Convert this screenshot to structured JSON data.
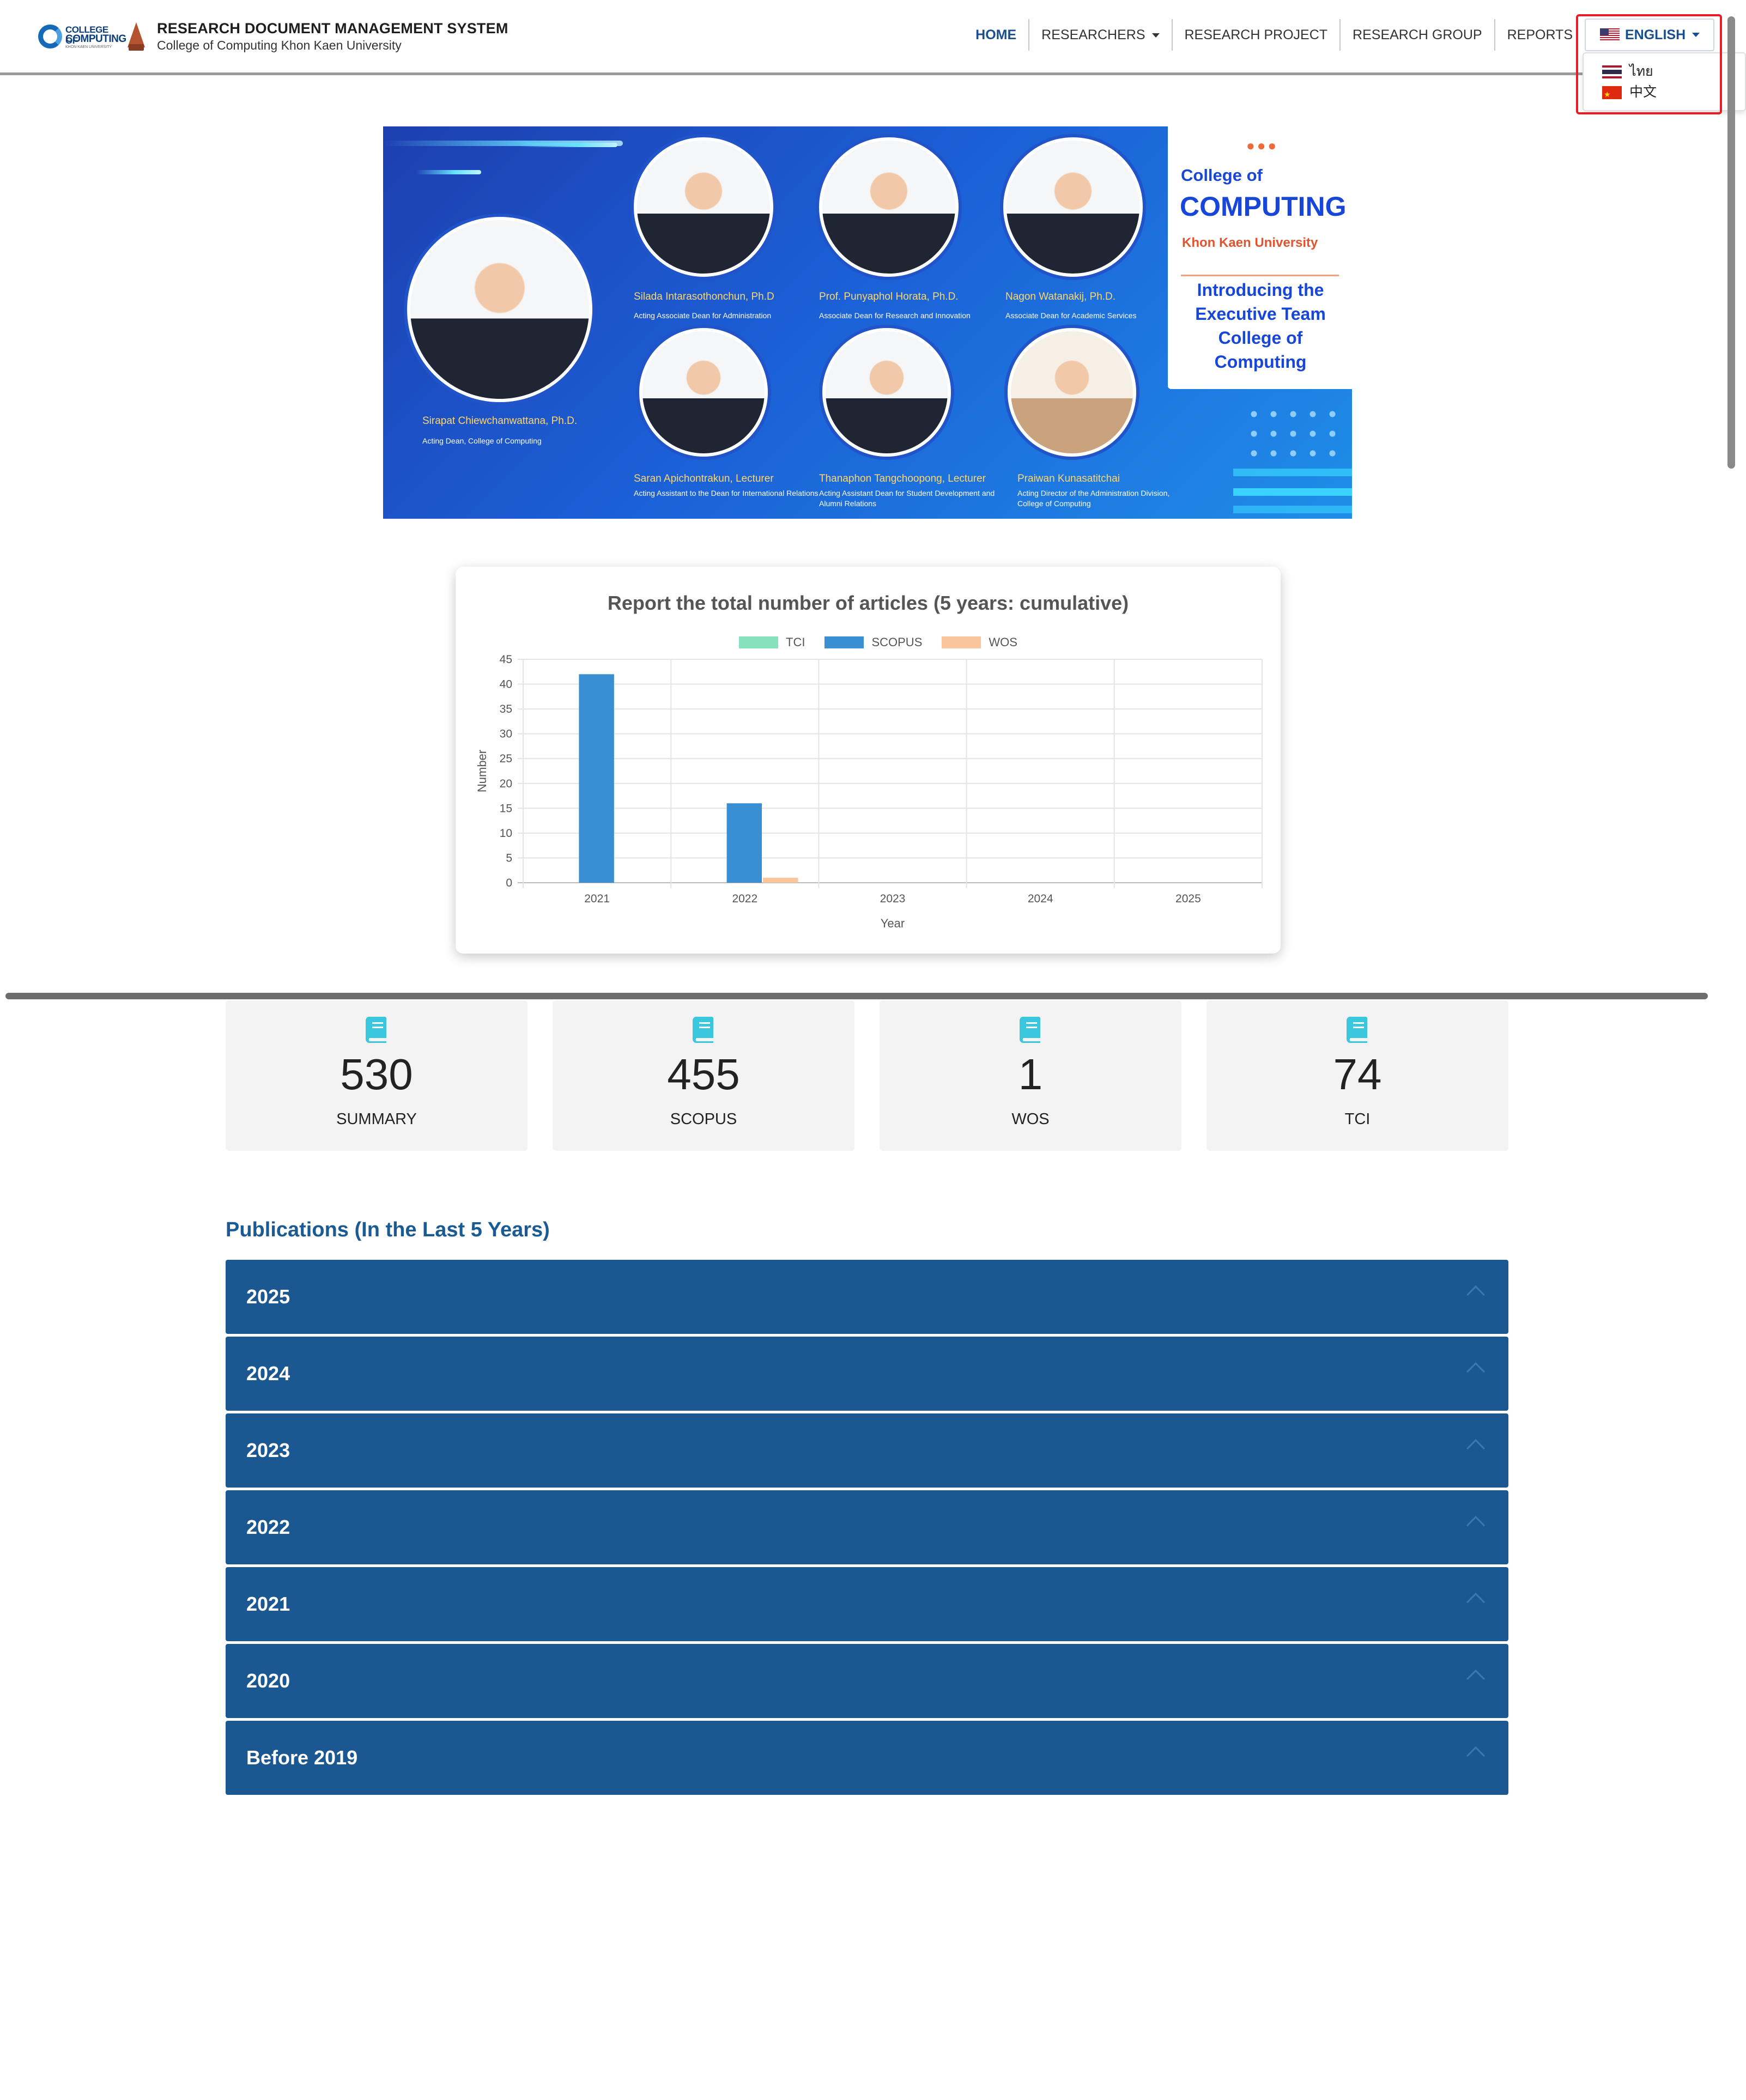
{
  "navbar": {
    "logo_college_line1": "COLLEGE OF",
    "logo_college_line2": "COMPUTING",
    "logo_college_line3": "KHON KAEN UNIVERSITY",
    "title": "RESEARCH DOCUMENT MANAGEMENT SYSTEM",
    "subtitle": "College of Computing Khon Kaen University",
    "items": [
      {
        "label": "HOME",
        "active": true
      },
      {
        "label": "RESEARCHERS",
        "dropdown": true
      },
      {
        "label": "RESEARCH PROJECT"
      },
      {
        "label": "RESEARCH GROUP"
      },
      {
        "label": "REPORTS"
      }
    ],
    "language": {
      "current": "ENGLISH",
      "current_flag": "us-flag-icon",
      "options": [
        {
          "label": "ไทย",
          "flag": "th-flag-icon"
        },
        {
          "label": "中文",
          "flag": "cn-flag-icon"
        }
      ]
    }
  },
  "banner": {
    "panel_college": "College of",
    "panel_computing": "COMPUTING",
    "panel_university": "Khon Kaen University",
    "panel_intro": "Introducing the Executive Team College of Computing",
    "people": [
      {
        "name": "Sirapat Chiewchanwattana, Ph.D.",
        "role": "Acting Dean, College of Computing"
      },
      {
        "name": "Silada Intarasothonchun, Ph.D",
        "role": "Acting Associate Dean for Administration"
      },
      {
        "name": "Prof. Punyaphol Horata, Ph.D.",
        "role": "Associate Dean for Research and Innovation"
      },
      {
        "name": "Nagon Watanakij, Ph.D.",
        "role": "Associate Dean for Academic Services"
      },
      {
        "name": "Saran Apichontrakun, Lecturer",
        "role": "Acting Assistant to the Dean for International Relations"
      },
      {
        "name": "Thanaphon Tangchoopong, Lecturer",
        "role": "Acting Assistant Dean for Student Development and Alumni Relations"
      },
      {
        "name": "Praiwan Kunasatitchai",
        "role": "Acting Director of the Administration Division, College of Computing"
      }
    ]
  },
  "chart_data": {
    "type": "bar",
    "title": "Report the total number of articles (5 years: cumulative)",
    "categories": [
      "2021",
      "2022",
      "2023",
      "2024",
      "2025"
    ],
    "series": [
      {
        "name": "TCI",
        "color": "#86e3b9",
        "values": [
          0,
          0,
          0,
          0,
          0
        ]
      },
      {
        "name": "SCOPUS",
        "color": "#3a8fd3",
        "values": [
          42,
          16,
          0,
          0,
          0
        ]
      },
      {
        "name": "WOS",
        "color": "#fbc59b",
        "values": [
          0,
          1,
          0,
          0,
          0
        ]
      }
    ],
    "xlabel": "Year",
    "ylabel": "Number",
    "ylim": [
      0,
      45
    ],
    "yticks": [
      0,
      5,
      10,
      15,
      20,
      25,
      30,
      35,
      40,
      45
    ],
    "grid": true,
    "legend_position": "top"
  },
  "stats": [
    {
      "value": "530",
      "label": "SUMMARY",
      "icon": "book-icon"
    },
    {
      "value": "455",
      "label": "SCOPUS",
      "icon": "book-icon"
    },
    {
      "value": "1",
      "label": "WOS",
      "icon": "book-icon"
    },
    {
      "value": "74",
      "label": "TCI",
      "icon": "book-icon"
    }
  ],
  "publications": {
    "heading": "Publications (In the Last 5 Years)",
    "years": [
      "2025",
      "2024",
      "2023",
      "2022",
      "2021",
      "2020",
      "Before 2019"
    ]
  },
  "colors": {
    "nav_active": "#1a4f8f",
    "accordion_bg": "#1b5891",
    "highlight": "#e21f26",
    "book_icon": "#3ac6dc"
  }
}
